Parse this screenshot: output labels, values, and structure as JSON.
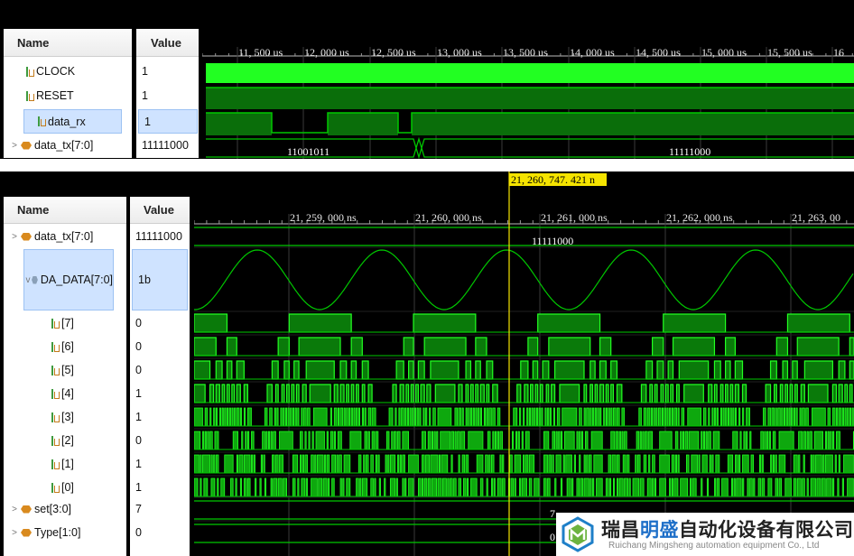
{
  "top_panel": {
    "name_header": "Name",
    "value_header": "Value",
    "signals": [
      {
        "name": "CLOCK",
        "value": "1",
        "icon": "bit-icon",
        "expander": ""
      },
      {
        "name": "RESET",
        "value": "1",
        "icon": "bit-icon",
        "expander": ""
      },
      {
        "name": "data_rx",
        "value": "1",
        "icon": "bit-icon",
        "expander": ""
      },
      {
        "name": "data_tx[7:0]",
        "value": "11111000",
        "icon": "bus-icon",
        "expander": ">"
      }
    ],
    "time_labels": [
      "11, 500 us",
      "12, 000 us",
      "12, 500 us",
      "13, 000 us",
      "13, 500 us",
      "14, 000 us",
      "14, 500 us",
      "15, 000 us",
      "15, 500 us",
      "16"
    ],
    "bus_values": [
      "11001011",
      "11111000"
    ]
  },
  "bottom_panel": {
    "name_header": "Name",
    "value_header": "Value",
    "cursor_label": "21, 260, 747. 421 n",
    "time_labels": [
      "21, 259, 000 ns",
      "21, 260, 000 ns",
      "21, 261, 000 ns",
      "21, 262, 000 ns",
      "21, 263, 00"
    ],
    "signals": [
      {
        "name": "data_tx[7:0]",
        "value": "11111000",
        "icon": "bus-icon",
        "expander": ">"
      },
      {
        "name": "DA_DATA[7:0]",
        "value": "1b",
        "icon": "analog-bus-icon",
        "expander": "v"
      },
      {
        "name": "[7]",
        "value": "0",
        "icon": "bit-icon",
        "expander": ""
      },
      {
        "name": "[6]",
        "value": "0",
        "icon": "bit-icon",
        "expander": ""
      },
      {
        "name": "[5]",
        "value": "0",
        "icon": "bit-icon",
        "expander": ""
      },
      {
        "name": "[4]",
        "value": "1",
        "icon": "bit-icon",
        "expander": ""
      },
      {
        "name": "[3]",
        "value": "1",
        "icon": "bit-icon",
        "expander": ""
      },
      {
        "name": "[2]",
        "value": "0",
        "icon": "bit-icon",
        "expander": ""
      },
      {
        "name": "[1]",
        "value": "1",
        "icon": "bit-icon",
        "expander": ""
      },
      {
        "name": "[0]",
        "value": "1",
        "icon": "bit-icon",
        "expander": ""
      },
      {
        "name": "set[3:0]",
        "value": "7",
        "icon": "bus-icon",
        "expander": ">"
      },
      {
        "name": "Type[1:0]",
        "value": "0",
        "icon": "bus-icon",
        "expander": ">"
      }
    ],
    "bus_values": {
      "data_tx": "11111000",
      "set": "7",
      "type": "0"
    }
  },
  "watermark": {
    "cn_part1": "瑞昌",
    "cn_highlight": "明盛",
    "cn_part2": "自动化设备有限公司",
    "en": "Ruichang Mingsheng automation equipment Co., Ltd"
  },
  "colors": {
    "wave_green": "#00c800",
    "bright_green": "#22ff22",
    "grid": "#3a3a3a",
    "cursor": "#f5e400",
    "selection": "#cfe3ff"
  }
}
